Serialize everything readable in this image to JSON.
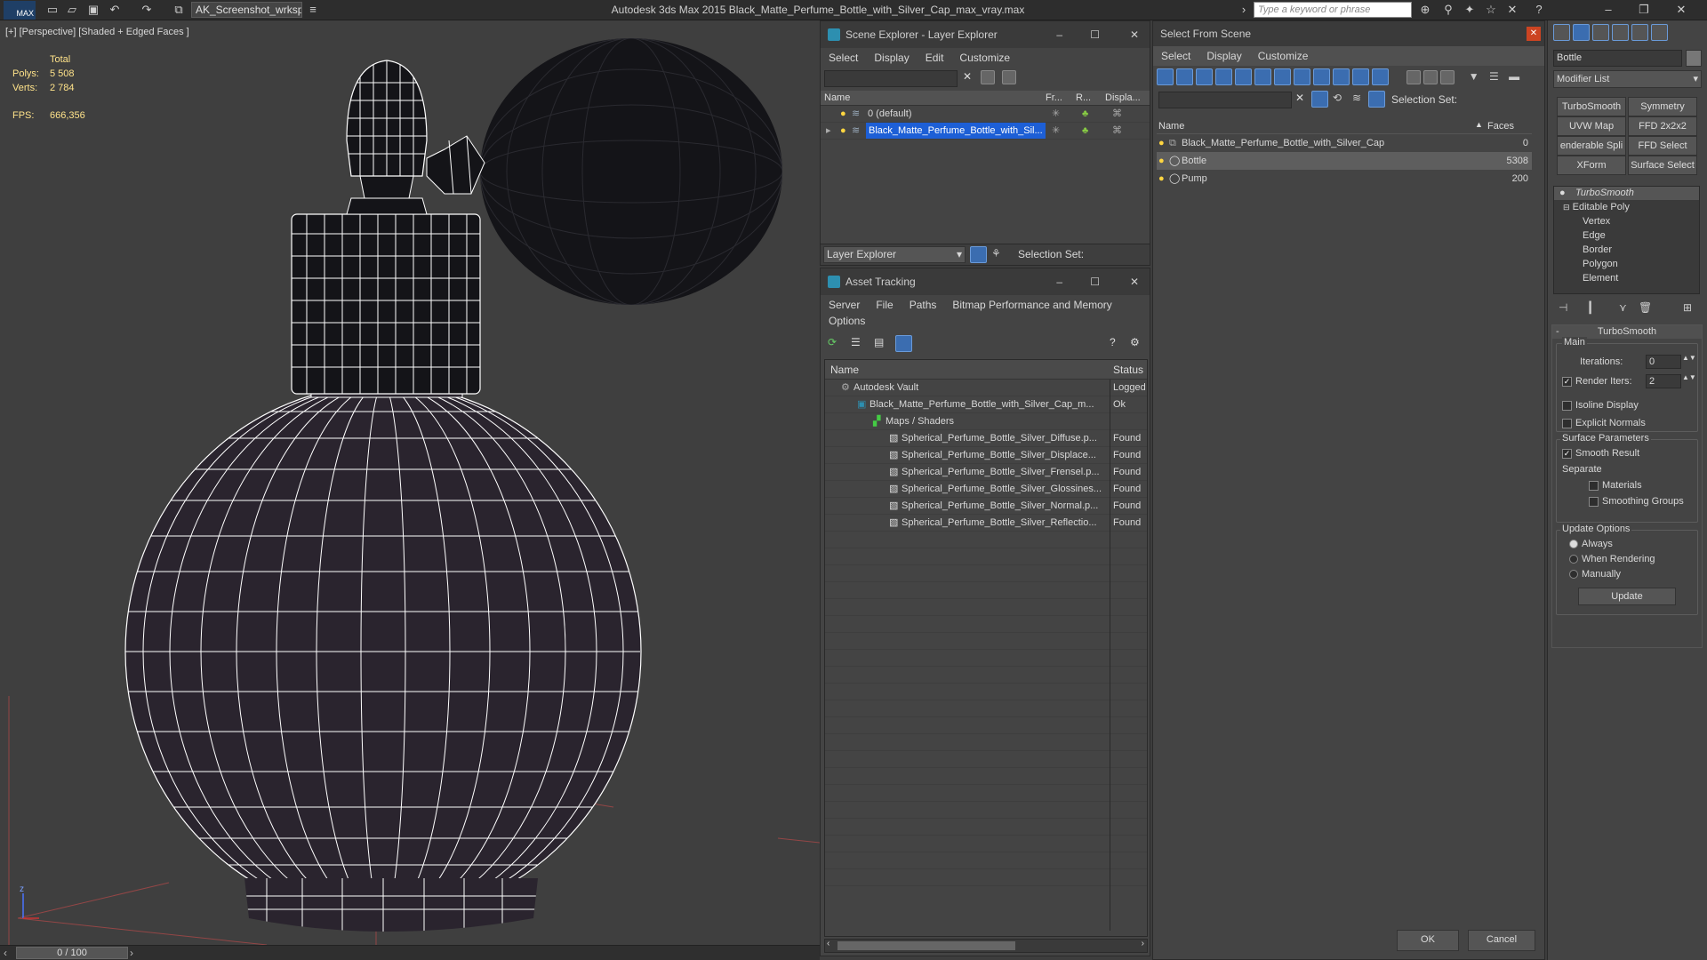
{
  "app": {
    "workspace": "AK_Screenshot_wrksp",
    "title": "Autodesk 3ds Max  2015    Black_Matte_Perfume_Bottle_with_Silver_Cap_max_vray.max",
    "logo": "MAX",
    "search_placeholder": "Type a keyword or phrase"
  },
  "viewport": {
    "label": "[+] [Perspective] [Shaded + Edged Faces ]",
    "stats_total": "Total",
    "polys_label": "Polys:",
    "polys_value": "5 508",
    "verts_label": "Verts:",
    "verts_value": "2 784",
    "fps_label": "FPS:",
    "fps_value": "666,356",
    "axis_z": "z"
  },
  "timeline": {
    "frame": "0 / 100"
  },
  "scene_explorer": {
    "title": "Scene Explorer - Layer Explorer",
    "menu": [
      "Select",
      "Display",
      "Edit",
      "Customize"
    ],
    "columns": [
      "Name",
      "Fr...",
      "R...",
      "Displa..."
    ],
    "rows": [
      {
        "name": "0 (default)"
      },
      {
        "name": "Black_Matte_Perfume_Bottle_with_Sil..."
      }
    ],
    "footer_dropdown": "Layer Explorer",
    "footer_selset": "Selection Set:"
  },
  "asset_tracking": {
    "title": "Asset Tracking",
    "menu": [
      "Server",
      "File",
      "Paths",
      "Bitmap Performance and Memory"
    ],
    "menu2": "Options",
    "columns": [
      "Name",
      "Status"
    ],
    "rows": [
      {
        "name": "Autodesk Vault",
        "status": "Logged"
      },
      {
        "name": "Black_Matte_Perfume_Bottle_with_Silver_Cap_m...",
        "status": "Ok"
      },
      {
        "name": "Maps / Shaders",
        "status": ""
      },
      {
        "name": "Spherical_Perfume_Bottle_Silver_Diffuse.p...",
        "status": "Found"
      },
      {
        "name": "Spherical_Perfume_Bottle_Silver_Displace...",
        "status": "Found"
      },
      {
        "name": "Spherical_Perfume_Bottle_Silver_Frensel.p...",
        "status": "Found"
      },
      {
        "name": "Spherical_Perfume_Bottle_Silver_Glossines...",
        "status": "Found"
      },
      {
        "name": "Spherical_Perfume_Bottle_Silver_Normal.p...",
        "status": "Found"
      },
      {
        "name": "Spherical_Perfume_Bottle_Silver_Reflectio...",
        "status": "Found"
      }
    ]
  },
  "select_from_scene": {
    "title": "Select From Scene",
    "menu": [
      "Select",
      "Display",
      "Customize"
    ],
    "selset_label": "Selection Set:",
    "columns": [
      "Name",
      "Faces"
    ],
    "rows": [
      {
        "name": "Black_Matte_Perfume_Bottle_with_Silver_Cap",
        "faces": "0"
      },
      {
        "name": "Bottle",
        "faces": "5308"
      },
      {
        "name": "Pump",
        "faces": "200"
      }
    ],
    "ok": "OK",
    "cancel": "Cancel"
  },
  "command_panel": {
    "object_name": "Bottle",
    "modifier_list": "Modifier List",
    "buttons": [
      "TurboSmooth",
      "Symmetry",
      "UVW Map",
      "FFD 2x2x2",
      "enderable Spli",
      "FFD Select",
      "XForm",
      "Surface Select"
    ],
    "stack": [
      "TurboSmooth",
      "Editable Poly",
      "Vertex",
      "Edge",
      "Border",
      "Polygon",
      "Element"
    ],
    "rollout_title": "TurboSmooth",
    "main_label": "Main",
    "iterations_label": "Iterations:",
    "iterations_value": "0",
    "render_iters_label": "Render Iters:",
    "render_iters_value": "2",
    "isoline": "Isoline Display",
    "explicit_normals": "Explicit Normals",
    "surface_params": "Surface Parameters",
    "smooth_result": "Smooth Result",
    "separate": "Separate",
    "materials": "Materials",
    "smoothing_groups": "Smoothing Groups",
    "update_options": "Update Options",
    "always": "Always",
    "when_rendering": "When Rendering",
    "manually": "Manually",
    "update": "Update"
  }
}
